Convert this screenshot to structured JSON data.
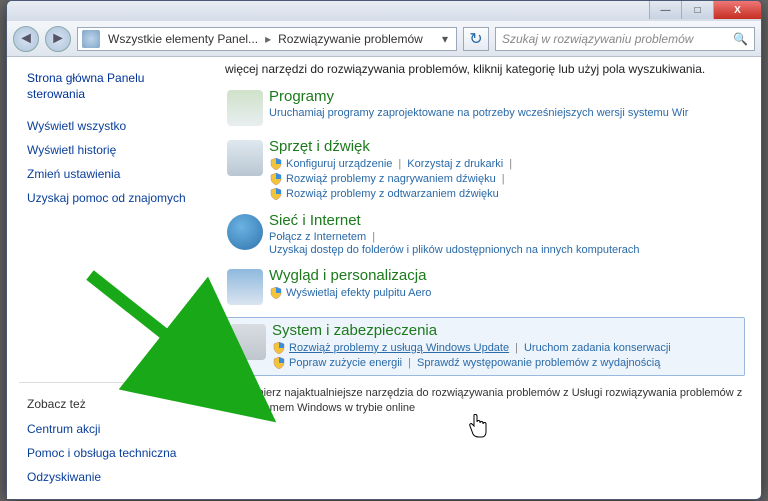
{
  "titlebar": {
    "min_label": "—",
    "max_label": "□",
    "close_label": "X"
  },
  "toolbar": {
    "back_glyph": "◄",
    "fwd_glyph": "►",
    "refresh_glyph": "↻",
    "search_glyph": "🔍",
    "breadcrumb": {
      "item1": "Wszystkie elementy Panel...",
      "item2": "Rozwiązywanie problemów",
      "sep": "▸",
      "dd": "▾"
    },
    "search_placeholder": "Szukaj w rozwiązywaniu problemów"
  },
  "sidebar": {
    "home": "Strona główna Panelu sterowania",
    "links": {
      "show_all": "Wyświetl wszystko",
      "history": "Wyświetl historię",
      "settings": "Zmień ustawienia",
      "help": "Uzyskaj pomoc od znajomych"
    },
    "also_head": "Zobacz też",
    "also": {
      "action_center": "Centrum akcji",
      "tech_help": "Pomoc i obsługa techniczna",
      "recovery": "Odzyskiwanie"
    }
  },
  "main": {
    "intro_line2": "więcej narzędzi do rozwiązywania problemów, kliknij kategorię lub użyj pola wyszukiwania.",
    "categories": {
      "programs": {
        "title": "Programy",
        "desc": "Uruchamiaj programy zaprojektowane na potrzeby wcześniejszych wersji systemu Wir"
      },
      "hardware": {
        "title": "Sprzęt i dźwięk",
        "items": {
          "cfg": "Konfiguruj urządzenie",
          "printer": "Korzystaj z drukarki",
          "record": "Rozwiąż problemy z nagrywaniem dźwięku",
          "playback": "Rozwiąż problemy z odtwarzaniem dźwięku"
        }
      },
      "network": {
        "title": "Sieć i Internet",
        "connect": "Połącz z Internetem",
        "access": "Uzyskaj dostęp do folderów i plików udostępnionych na innych komputerach"
      },
      "appearance": {
        "title": "Wygląd i personalizacja",
        "aero": "Wyświetlaj efekty pulpitu Aero"
      },
      "system": {
        "title": "System i zabezpieczenia",
        "items": {
          "wupdate": "Rozwiąż problemy z usługą Windows Update",
          "maint": "Uruchom zadania konserwacji",
          "power": "Popraw zużycie energii",
          "perf": "Sprawdź występowanie problemów z wydajnością"
        }
      }
    },
    "footer_checkbox_label": "Pobierz najaktualniejsze narzędzia do rozwiązywania problemów z Usługi rozwiązywania problemów z systemem Windows w trybie online"
  }
}
